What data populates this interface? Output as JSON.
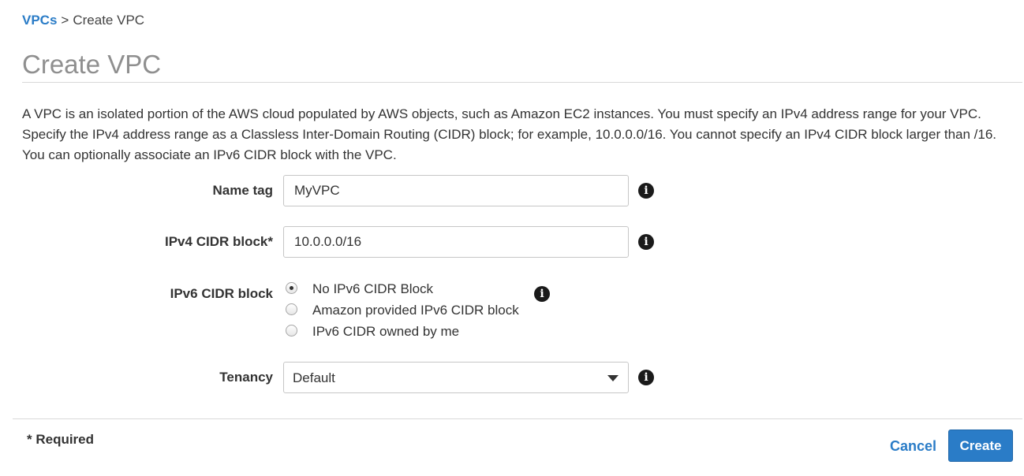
{
  "breadcrumb": {
    "parent": "VPCs",
    "separator": ">",
    "current": "Create VPC"
  },
  "page_title": "Create VPC",
  "description": "A VPC is an isolated portion of the AWS cloud populated by AWS objects, such as Amazon EC2 instances. You must specify an IPv4 address range for your VPC. Specify the IPv4 address range as a Classless Inter-Domain Routing (CIDR) block; for example, 10.0.0.0/16. You cannot specify an IPv4 CIDR block larger than /16. You can optionally associate an IPv6 CIDR block with the VPC.",
  "form": {
    "name_tag": {
      "label": "Name tag",
      "value": "MyVPC",
      "info_icon": "info-icon"
    },
    "ipv4_cidr": {
      "label": "IPv4 CIDR block*",
      "value": "10.0.0.0/16",
      "info_icon": "info-icon"
    },
    "ipv6_cidr": {
      "label": "IPv6 CIDR block",
      "options": [
        {
          "label": "No IPv6 CIDR Block",
          "selected": true
        },
        {
          "label": "Amazon provided IPv6 CIDR block",
          "selected": false
        },
        {
          "label": "IPv6 CIDR owned by me",
          "selected": false
        }
      ],
      "info_icon": "info-icon"
    },
    "tenancy": {
      "label": "Tenancy",
      "selected": "Default",
      "info_icon": "info-icon"
    }
  },
  "footer": {
    "required_note": "* Required",
    "cancel_label": "Cancel",
    "create_label": "Create"
  },
  "colors": {
    "accent": "#2a7cc7",
    "title_gray": "#8f8f8f",
    "text": "#333333"
  }
}
